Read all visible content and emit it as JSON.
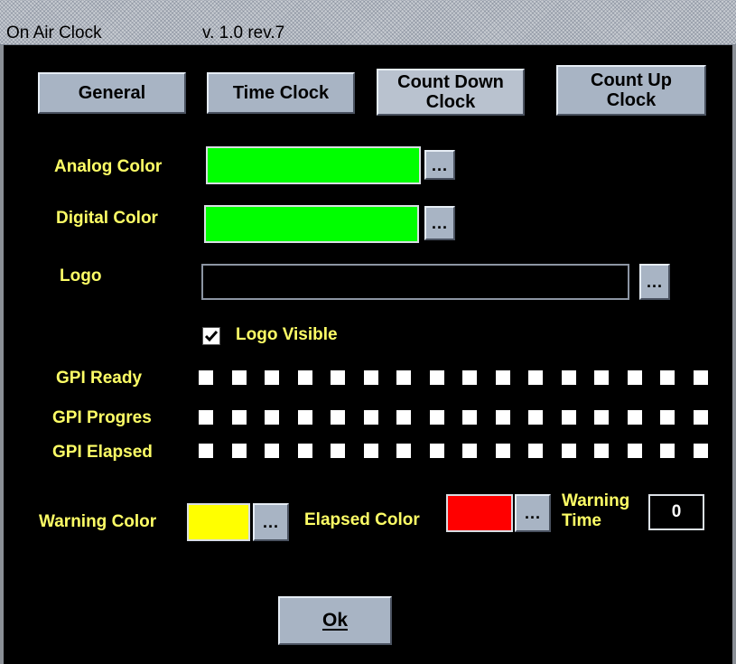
{
  "window": {
    "title": "On Air Clock",
    "version": "v. 1.0  rev.7"
  },
  "tabs": [
    {
      "label": "General"
    },
    {
      "label": "Time Clock"
    },
    {
      "label": "Count Down\nClock"
    },
    {
      "label": "Count Up\nClock"
    }
  ],
  "fields": {
    "analog_color": {
      "label": "Analog Color",
      "color": "#00ff00"
    },
    "digital_color": {
      "label": "Digital Color",
      "color": "#00ff00"
    },
    "logo": {
      "label": "Logo",
      "value": ""
    },
    "browse_label": "...",
    "logo_visible": {
      "label": "Logo Visible",
      "checked": true
    }
  },
  "gpi": {
    "rows": [
      {
        "label": "GPI Ready"
      },
      {
        "label": "GPI Progres"
      },
      {
        "label": "GPI Elapsed"
      }
    ],
    "count": 16
  },
  "bottom": {
    "warning_color": {
      "label": "Warning Color",
      "color": "#ffff00"
    },
    "elapsed_color": {
      "label": "Elapsed Color",
      "color": "#ff0000"
    },
    "warning_time": {
      "label": "Warning\nTime",
      "value": "0"
    }
  },
  "ok_button": {
    "label": "Ok"
  }
}
